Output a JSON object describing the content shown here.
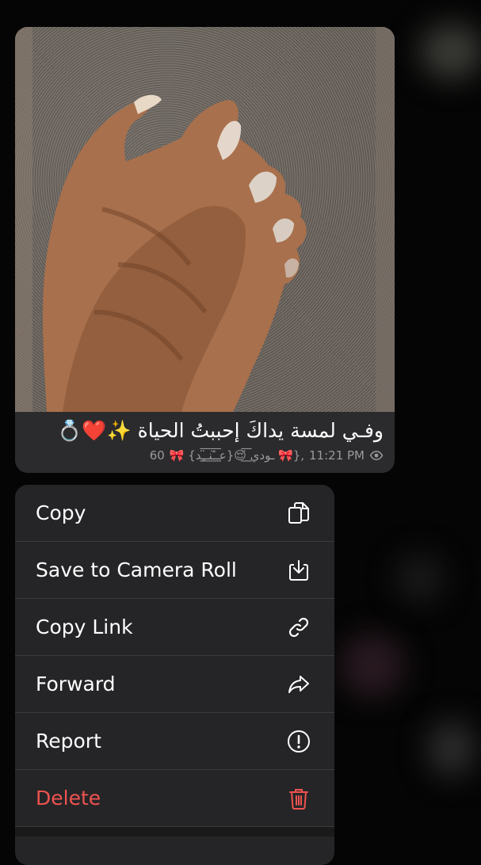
{
  "message": {
    "caption": "وفـي لمسة يداكَ إحببتُ الحياة ✨❤️💍",
    "views": "60",
    "sender": "🎀 {عـ̈͟͞ـَنـ̈͟͞ـِد}😌 ̈͟͞ـودي 🎀},",
    "time": "11:21 PM"
  },
  "menu": {
    "items": [
      {
        "label": "Copy",
        "icon": "copy-icon"
      },
      {
        "label": "Save to Camera Roll",
        "icon": "save-download-icon"
      },
      {
        "label": "Copy Link",
        "icon": "link-icon"
      },
      {
        "label": "Forward",
        "icon": "forward-arrow-icon"
      },
      {
        "label": "Report",
        "icon": "exclamation-circle-icon"
      },
      {
        "label": "Delete",
        "icon": "trash-icon"
      }
    ]
  },
  "colors": {
    "danger": "#ef5350",
    "menu_bg": "#252527",
    "bubble_bg": "#2b2b2d"
  }
}
